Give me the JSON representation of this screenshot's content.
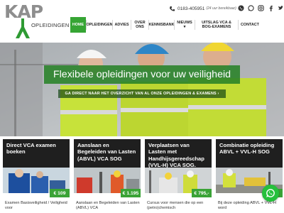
{
  "brand": {
    "logo_text": "KAP",
    "logo_word": "OPLEIDINGEN"
  },
  "topbar": {
    "phone": "0183-405951",
    "phone_note": "(24 uur bereikbaar)"
  },
  "socials": [
    "phone-icon",
    "whatsapp-icon",
    "instagram-icon",
    "facebook-icon",
    "twitter-icon",
    "youtube-icon"
  ],
  "nav": {
    "items": [
      "HOME",
      "OPLEIDINGEN",
      "ADVIES",
      "OVER ONS",
      "KENNISBANK",
      "NIEUWS ▾",
      "UITSLAG VCA & BOG-EXAMENS",
      "CONTACT"
    ],
    "active_index": 0
  },
  "hero": {
    "title": "Flexibele opleidingen voor uw veiligheid",
    "subtitle": "GA DIRECT NAAR HET OVERZICHT VAN AL ONZE OPLEIDINGEN & EXAMENS ›"
  },
  "courses": [
    {
      "title": "Direct VCA examen boeken",
      "price": "€ 109",
      "desc": "Examen Basisveiligheid / Veiligheid voor"
    },
    {
      "title": "Aanslaan en Begeleiden van Lasten (ABVL) VCA SOG",
      "price": "€ 1.195",
      "desc": "Aanslaan en Begeleiden van Lasten (ABVL) VCA"
    },
    {
      "title": "Verplaatsen van Lasten met Handhijsgereedschap (VVL-H) VCA SOG.",
      "price": "€ 795,-",
      "desc": "Cursus voor mensen die op een (petro)chemisch"
    },
    {
      "title": "Combinatie opleiding ABVL + VVL-H SOG",
      "price": "€ 1.4",
      "desc": "Bij deze opleiding ABVL + VVL-H word"
    }
  ],
  "colors": {
    "accent": "#36a534",
    "card_head": "#1f1f1f",
    "whatsapp": "#25c03c"
  }
}
